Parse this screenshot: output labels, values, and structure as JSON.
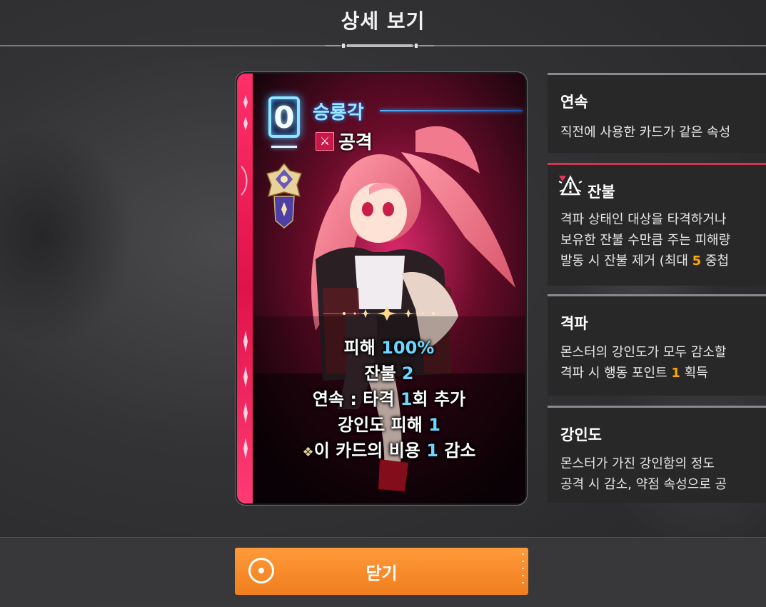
{
  "header": {
    "title": "상세 보기"
  },
  "card": {
    "cost": "0",
    "name": "승룡각",
    "type_label": "공격",
    "type_icon": "crossed-swords-icon",
    "effects": [
      {
        "pre": "피해 ",
        "value": "100%",
        "post": ""
      },
      {
        "pre": "잔불 ",
        "value": "2",
        "post": ""
      },
      {
        "pre": "연속 : 타격 ",
        "value": "1",
        "post": "회 추가"
      },
      {
        "pre": "강인도 피해 ",
        "value": "1",
        "post": ""
      },
      {
        "pre": "이 카드의 비용 ",
        "value": "1",
        "post": " 감소"
      }
    ],
    "accent_color": "#ff2f6a",
    "cost_glow_color": "#3fb7ff"
  },
  "panels": [
    {
      "title": "연속",
      "lines": [
        "직전에 사용한 카드가 같은 속성"
      ]
    },
    {
      "title": "잔불",
      "icon": "ember-warning-icon",
      "lines": [
        "격파 상태인 대상을 타격하거나",
        "보유한 잔불 수만큼 주는 피해량"
      ],
      "line3_pre": "발동 시 잔불 제거 (최대 ",
      "line3_num": "5",
      "line3_post": " 중첩"
    },
    {
      "title": "격파",
      "lines": [
        "몬스터의 강인도가 모두 감소할"
      ],
      "line2_pre": "격파 시 행동 포인트 ",
      "line2_num": "1",
      "line2_post": " 획득"
    },
    {
      "title": "강인도",
      "lines": [
        "몬스터가 가진 강인함의 정도",
        "공격 시 감소, 약점 속성으로 공"
      ]
    }
  ],
  "close_button": {
    "label": "닫기",
    "color": "#f58a2a"
  }
}
